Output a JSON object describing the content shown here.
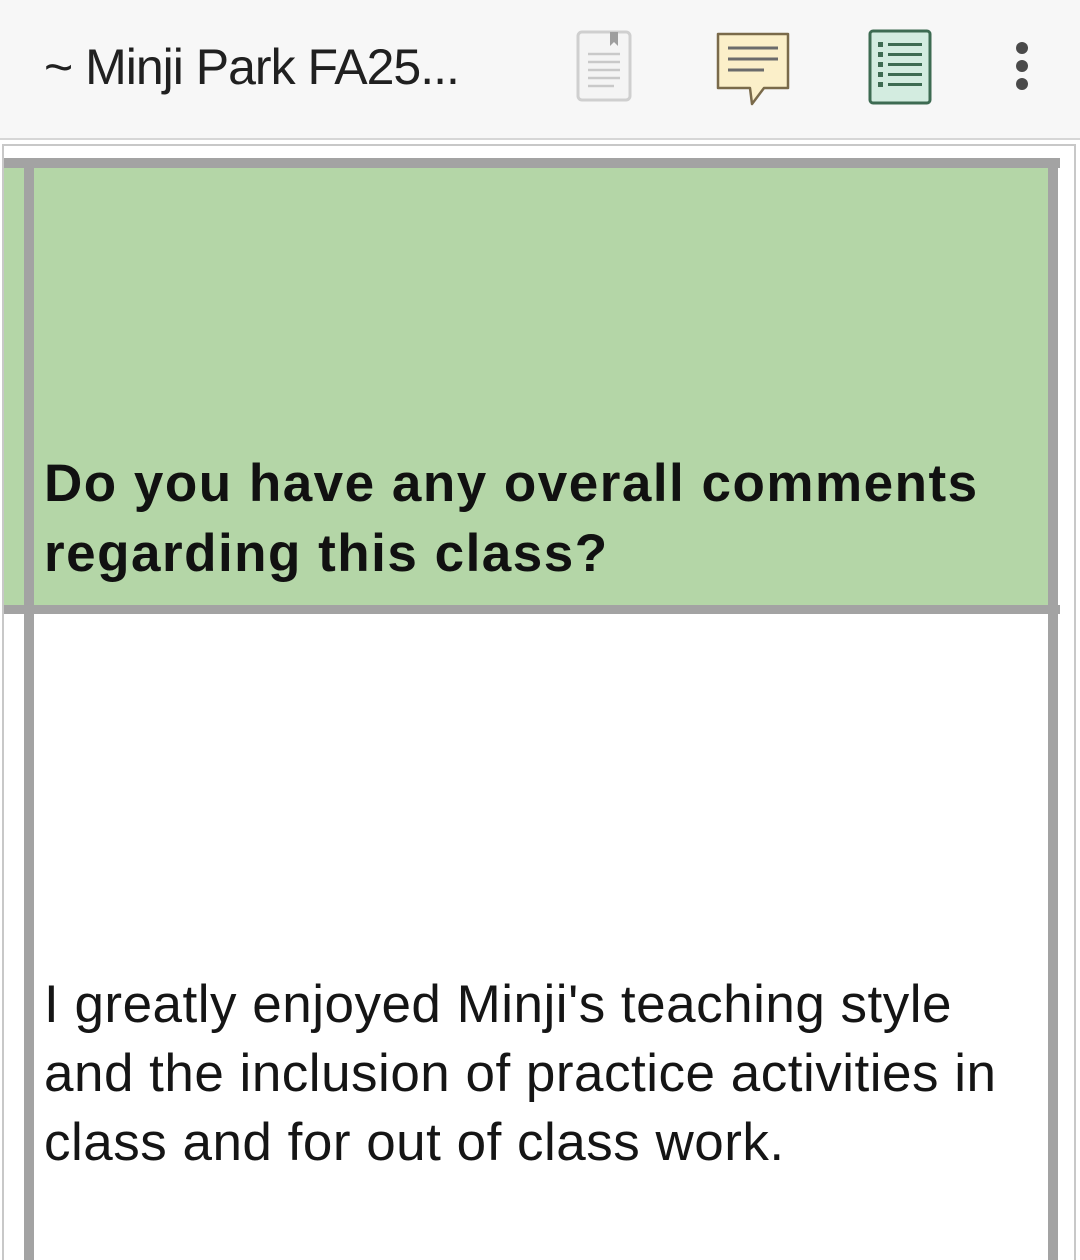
{
  "toolbar": {
    "title": "~ Minji Park FA25...",
    "icons": {
      "document": "document-icon",
      "comment": "comment-icon",
      "list": "list-view-icon",
      "more": "more-vertical-icon"
    }
  },
  "sheet": {
    "header_cell": {
      "text": "Do you have any overall comments regarding this class?",
      "background": "#b4d6a7"
    },
    "answer_cell": {
      "text": "I greatly enjoyed Minji's teaching style and the inclusion of practice activities in class and for out of class work."
    }
  }
}
